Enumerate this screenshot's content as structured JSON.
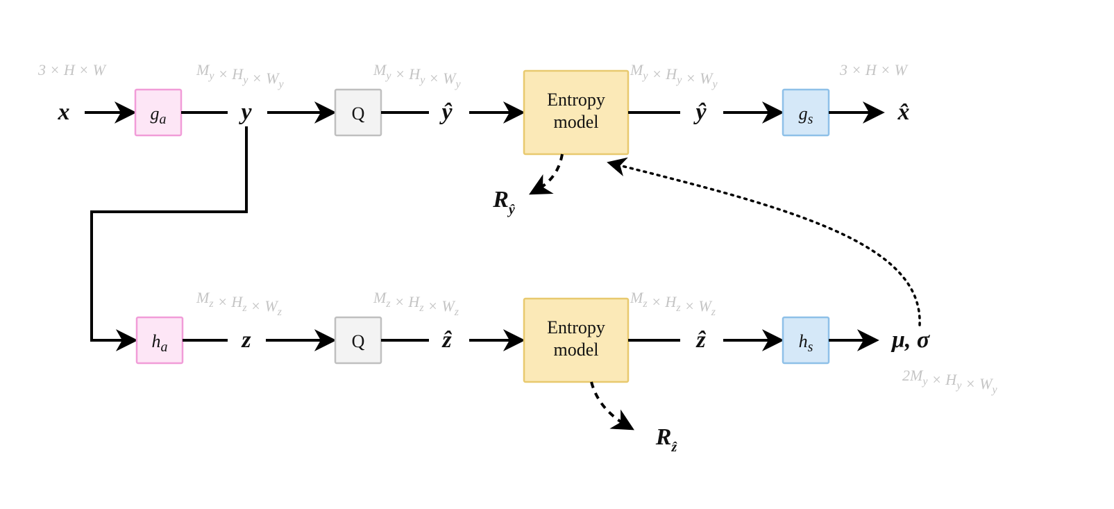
{
  "dims": {
    "x": "3 × H × W",
    "y": "M_y × H_y × W_y",
    "yh": "M_y × H_y × W_y",
    "yh2": "M_y × H_y × W_y",
    "xh": "3 × H × W",
    "z": "M_z × H_z × W_z",
    "zh": "M_z × H_z × W_z",
    "zh2": "M_z × H_z × W_z",
    "mu": "2M_y × H_y × W_y"
  },
  "vars": {
    "x": "x",
    "y": "y",
    "yh": "ŷ",
    "yh2": "ŷ",
    "xh": "x̂",
    "z": "z",
    "zh": "ẑ",
    "zh2": "ẑ",
    "mu": "μ, σ",
    "Ryh": "R",
    "Rzh": "R"
  },
  "blocks": {
    "ga": "g",
    "ga_sub": "a",
    "gs": "g",
    "gs_sub": "s",
    "ha": "h",
    "ha_sub": "a",
    "hs": "h",
    "hs_sub": "s",
    "Q1": "Q",
    "Q2": "Q",
    "ent": "Entropy",
    "ent2": "model"
  },
  "colors": {
    "pink": "#fde6f6",
    "pinkStroke": "#f19cd8",
    "gray": "#f3f3f3",
    "grayStroke": "#bfbfbf",
    "yellow": "#fbe9b7",
    "yellowStroke": "#e8c96e",
    "blue": "#d5e8f8",
    "blueStroke": "#8ec0e8"
  }
}
